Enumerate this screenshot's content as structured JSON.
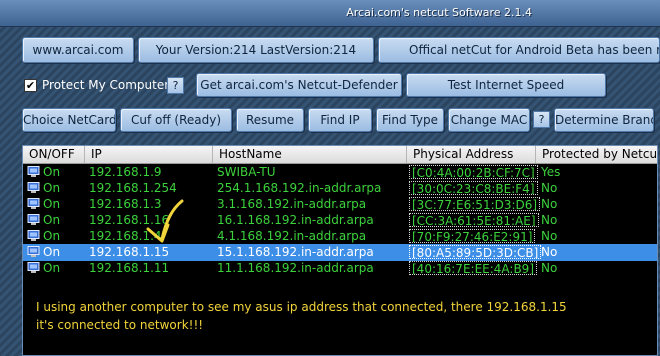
{
  "window": {
    "title": "Arcai.com's netcut Software 2.1.4"
  },
  "toolbar1": {
    "website": "www.arcai.com",
    "version": "Your Version:214 LastVersion:214",
    "android": "Offical netCut for Android Beta has been releas"
  },
  "toolbar2": {
    "protect_label": "Protect My Computer",
    "protect_checked": "✔",
    "help": "?",
    "defender": "Get arcai.com's Netcut-Defender",
    "speed": "Test Internet Speed"
  },
  "toolbar3": {
    "choice": "Choice NetCard",
    "cutoff": "Cuf off (Ready)",
    "resume": "Resume",
    "findip": "Find IP",
    "findtype": "Find Type",
    "changemac": "Change MAC",
    "help": "?",
    "brand": "Determine Brand"
  },
  "table": {
    "headers": [
      "ON/OFF",
      "IP",
      "HostName",
      "Physical Address",
      "Protected by Netcut"
    ],
    "rows": [
      {
        "state": "On",
        "ip": "192.168.1.9",
        "host": "SWIBA-TU",
        "mac": "[C0:4A:00:2B:CF:7C]",
        "prot": "Yes"
      },
      {
        "state": "On",
        "ip": "192.168.1.254",
        "host": "254.1.168.192.in-addr.arpa",
        "mac": "[30:0C:23:C8:BE:F4]",
        "prot": "No"
      },
      {
        "state": "On",
        "ip": "192.168.1.3",
        "host": "3.1.168.192.in-addr.arpa",
        "mac": "[3C:77:E6:51:D3:D6]",
        "prot": "No"
      },
      {
        "state": "On",
        "ip": "192.168.1.16",
        "host": "16.1.168.192.in-addr.arpa",
        "mac": "[CC:3A:61:5E:81:AE]",
        "prot": "No"
      },
      {
        "state": "On",
        "ip": "192.168.1.4",
        "host": "4.1.168.192.in-addr.arpa",
        "mac": "[70:F9:27:46:E2:91]",
        "prot": "No"
      },
      {
        "state": "On",
        "ip": "192.168.1.15",
        "host": "15.1.168.192.in-addr.arpa",
        "mac": "[80:A5:89:5D:3D:CB]",
        "prot": "No"
      },
      {
        "state": "On",
        "ip": "192.168.1.11",
        "host": "11.1.168.192.in-addr.arpa",
        "mac": "[40:16:7E:EE:4A:B9]",
        "prot": "No"
      }
    ]
  },
  "annotation": {
    "line1": "I using another computer to see my asus ip address that connected, there 192.168.1.15",
    "line2": "it's connected to network!!!"
  },
  "colors": {
    "row_text": "#3cd23c",
    "selected_row": "#3d8ee6",
    "annotation": "#f0d43a"
  },
  "icons": {
    "row_icon": "computer-icon",
    "arrow": "yellow-checkmark-arrow"
  }
}
